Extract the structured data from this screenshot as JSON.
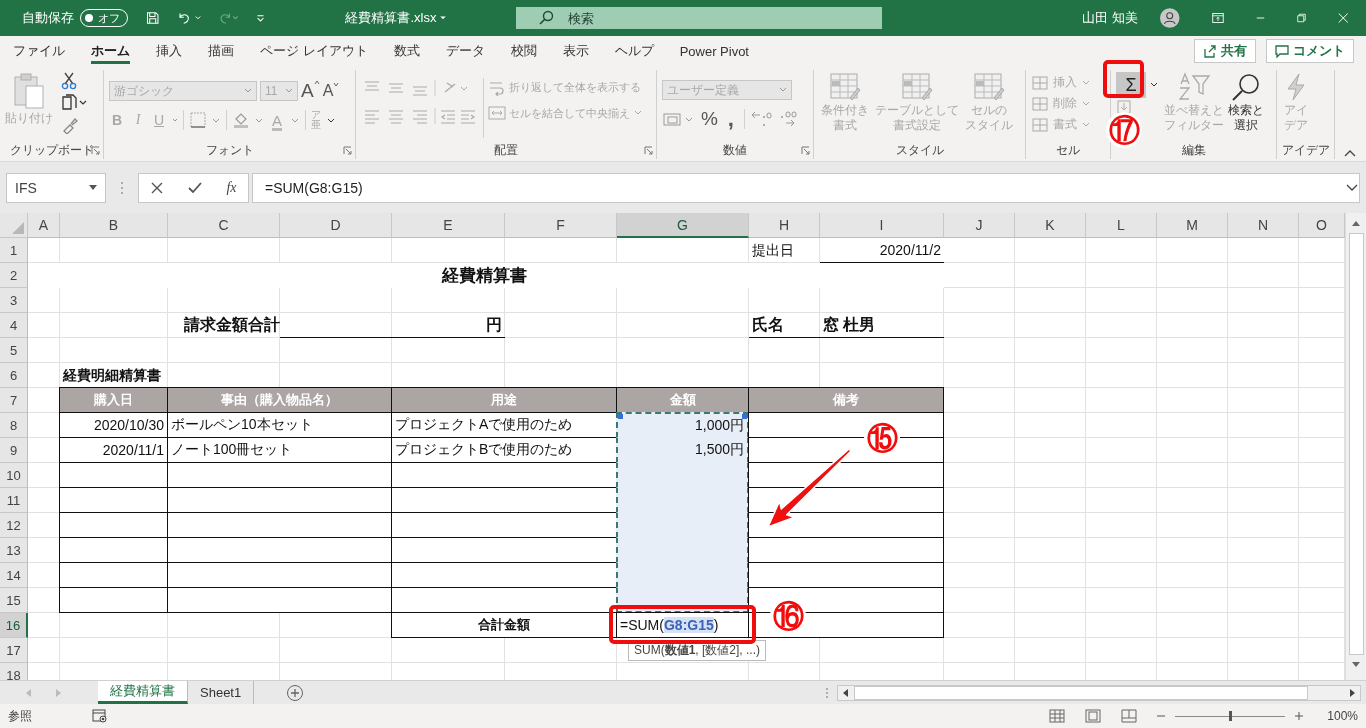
{
  "titlebar": {
    "autosave_label": "自動保存",
    "autosave": {
      "label": "オフ",
      "on": false
    },
    "redo": {
      "disabled": true
    },
    "filename": "経費精算書.xlsx",
    "search": {
      "placeholder": "検索"
    },
    "user": "山田 知美"
  },
  "tabs": [
    {
      "label": "ファイル",
      "selected": false
    },
    {
      "label": "ホーム",
      "selected": true
    },
    {
      "label": "挿入",
      "selected": false
    },
    {
      "label": "描画",
      "selected": false
    },
    {
      "label": "ページ レイアウト",
      "selected": false
    },
    {
      "label": "数式",
      "selected": false
    },
    {
      "label": "データ",
      "selected": false
    },
    {
      "label": "校閲",
      "selected": false
    },
    {
      "label": "表示",
      "selected": false
    },
    {
      "label": "ヘルプ",
      "selected": false
    },
    {
      "label": "Power Pivot",
      "selected": false
    }
  ],
  "share_button": "共有",
  "comment_button": "コメント",
  "ribbon": {
    "groups": [
      {
        "kind": "clipboard",
        "label": "クリップボード",
        "launcher": true,
        "items": [
          {
            "label": [
              "貼り付け"
            ],
            "disabled": true
          }
        ]
      },
      {
        "kind": "font",
        "label": "フォント",
        "launcher": true,
        "items": [
          {
            "value": "游ゴシック",
            "disabled": true
          },
          {
            "value": "11",
            "disabled": true
          },
          {
            "label": "A",
            "disabled": false
          },
          {
            "label": "A",
            "disabled": false
          },
          {
            "label": "B",
            "disabled": true
          },
          {
            "label": "I",
            "disabled": true
          },
          {
            "label": "U",
            "disabled": true
          },
          {
            "label": "A",
            "disabled": true
          },
          {
            "label": "ア亜",
            "disabled": true
          }
        ]
      },
      {
        "kind": "alignment",
        "label": "配置",
        "launcher": true,
        "items": [
          {
            "label": "折り返して全体を表示する",
            "disabled": true
          },
          {
            "label": "セルを結合して中央揃え",
            "disabled": true
          }
        ]
      },
      {
        "kind": "number",
        "label": "数値",
        "launcher": true,
        "items": [
          {
            "value": "ユーザー定義",
            "disabled": true
          },
          {
            "label": "%",
            "disabled": false
          },
          {
            "label": ",",
            "disabled": false
          }
        ]
      },
      {
        "kind": "styles",
        "label": "スタイル",
        "items": [
          {
            "label": [
              "条件付き",
              "書式"
            ],
            "disabled": true
          },
          {
            "label": [
              "テーブルとして",
              "書式設定"
            ],
            "disabled": true
          },
          {
            "label": [
              "セルの",
              "スタイル"
            ],
            "disabled": true
          }
        ]
      },
      {
        "kind": "cells",
        "label": "セル",
        "items": [
          {
            "label": "挿入",
            "disabled": true
          },
          {
            "label": "削除",
            "disabled": true
          },
          {
            "label": "書式",
            "disabled": true
          }
        ]
      },
      {
        "kind": "editing",
        "label": "編集",
        "items": [
          {
            "label": "Σ",
            "disabled": false
          },
          {
            "label": [
              "並べ替えと",
              "フィルター"
            ],
            "disabled": true
          },
          {
            "label": [
              "検索と",
              "選択"
            ],
            "disabled": false
          }
        ]
      },
      {
        "kind": "ideas",
        "label": "アイデア",
        "items": [
          {
            "label": [
              "アイ",
              "デア"
            ],
            "disabled": true
          }
        ]
      }
    ]
  },
  "formula_bar": {
    "name_box": "IFS",
    "function_button": "fx",
    "formula": "=SUM(G8:G15)"
  },
  "sheet": {
    "columns": [
      {
        "label": "A",
        "selected": false
      },
      {
        "label": "B",
        "selected": false
      },
      {
        "label": "C",
        "selected": false
      },
      {
        "label": "D",
        "selected": false
      },
      {
        "label": "E",
        "selected": false
      },
      {
        "label": "F",
        "selected": false
      },
      {
        "label": "G",
        "selected": true
      },
      {
        "label": "H",
        "selected": false
      },
      {
        "label": "I",
        "selected": false
      },
      {
        "label": "J",
        "selected": false
      },
      {
        "label": "K",
        "selected": false
      },
      {
        "label": "L",
        "selected": false
      },
      {
        "label": "M",
        "selected": false
      },
      {
        "label": "N",
        "selected": false
      },
      {
        "label": "O",
        "selected": false
      }
    ],
    "rows": [
      {
        "number": "1",
        "selected": false,
        "cells": [
          "",
          "",
          "",
          "",
          "",
          "",
          "",
          {
            "text": "提出日",
            "kind": "plain"
          },
          {
            "text": "2020/11/2",
            "kind": "underline-right"
          }
        ]
      },
      {
        "number": "2",
        "selected": false,
        "cells": [
          "",
          "",
          "",
          "",
          {
            "text": "経費精算書",
            "kind": "title"
          }
        ]
      },
      {
        "number": "3",
        "selected": false
      },
      {
        "number": "4",
        "selected": false,
        "cells": [
          "",
          "",
          {
            "text": "請求金額合計",
            "kind": "label-right"
          },
          {
            "kind": "underline"
          },
          {
            "text": "円",
            "kind": "underline-bold-right"
          },
          "",
          "",
          {
            "text": "氏名",
            "kind": "underline-bold"
          },
          {
            "text": "窓 杜男",
            "kind": "underline-bold"
          }
        ]
      },
      {
        "number": "5",
        "selected": false
      },
      {
        "number": "6",
        "selected": false,
        "cells": [
          "",
          {
            "text": "経費明細精算書",
            "kind": "section"
          }
        ]
      },
      {
        "number": "7",
        "selected": false,
        "cells": [
          "",
          {
            "text": "購入日",
            "kind": "header",
            "merged": false
          },
          {
            "text": "事由（購入物品名）",
            "kind": "header",
            "merged": true
          },
          "",
          {
            "text": "用途",
            "kind": "header",
            "merged": true
          },
          "",
          {
            "text": "金額",
            "kind": "header",
            "merged": false
          },
          {
            "text": "備考",
            "kind": "header",
            "merged": true
          }
        ]
      },
      {
        "number": "8",
        "selected": false,
        "cells": [
          "",
          {
            "text": "2020/10/30",
            "kind": "date",
            "merged": false
          },
          {
            "text": "ボールペン10本セット",
            "kind": "text",
            "merged": true
          },
          "",
          {
            "text": "プロジェクトAで使用のため",
            "kind": "text",
            "merged": true
          },
          "",
          {
            "text": "1,000円",
            "kind": "amount",
            "merged": false,
            "copy_range": true
          },
          {
            "kind": "box",
            "merged": true
          }
        ]
      },
      {
        "number": "9",
        "selected": false,
        "cells": [
          "",
          {
            "text": "2020/11/1",
            "kind": "date",
            "merged": false
          },
          {
            "text": "ノート100冊セット",
            "kind": "text",
            "merged": true
          },
          "",
          {
            "text": "プロジェクトBで使用のため",
            "kind": "text",
            "merged": true
          },
          "",
          {
            "text": "1,500円",
            "kind": "amount",
            "merged": false,
            "copy_range": true
          },
          {
            "kind": "box",
            "merged": true
          }
        ]
      },
      {
        "number": "10",
        "selected": false,
        "cells": [
          "",
          {
            "kind": "box",
            "merged": false
          },
          {
            "kind": "box",
            "merged": true
          },
          "",
          {
            "kind": "box",
            "merged": true
          },
          "",
          {
            "kind": "amount",
            "merged": false,
            "copy_range": true
          },
          {
            "kind": "box",
            "merged": true
          }
        ]
      },
      {
        "number": "11",
        "selected": false,
        "cells": [
          "",
          {
            "kind": "box",
            "merged": false
          },
          {
            "kind": "box",
            "merged": true
          },
          "",
          {
            "kind": "box",
            "merged": true
          },
          "",
          {
            "kind": "amount",
            "merged": false,
            "copy_range": true
          },
          {
            "kind": "box",
            "merged": true
          }
        ]
      },
      {
        "number": "12",
        "selected": false,
        "cells": [
          "",
          {
            "kind": "box",
            "merged": false
          },
          {
            "kind": "box",
            "merged": true
          },
          "",
          {
            "kind": "box",
            "merged": true
          },
          "",
          {
            "kind": "amount",
            "merged": false,
            "copy_range": true
          },
          {
            "kind": "box",
            "merged": true
          }
        ]
      },
      {
        "number": "13",
        "selected": false,
        "cells": [
          "",
          {
            "kind": "box",
            "merged": false
          },
          {
            "kind": "box",
            "merged": true
          },
          "",
          {
            "kind": "box",
            "merged": true
          },
          "",
          {
            "kind": "amount",
            "merged": false,
            "copy_range": true
          },
          {
            "kind": "box",
            "merged": true
          }
        ]
      },
      {
        "number": "14",
        "selected": false,
        "cells": [
          "",
          {
            "kind": "box",
            "merged": false
          },
          {
            "kind": "box",
            "merged": true
          },
          "",
          {
            "kind": "box",
            "merged": true
          },
          "",
          {
            "kind": "amount",
            "merged": false,
            "copy_range": true
          },
          {
            "kind": "box",
            "merged": true
          }
        ]
      },
      {
        "number": "15",
        "selected": false,
        "cells": [
          "",
          {
            "kind": "box",
            "merged": false
          },
          {
            "kind": "box",
            "merged": true
          },
          "",
          {
            "kind": "box",
            "merged": true
          },
          "",
          {
            "kind": "amount",
            "merged": false,
            "copy_range": true
          },
          {
            "kind": "box",
            "merged": true
          }
        ]
      },
      {
        "number": "16",
        "selected": true,
        "cells": [
          "",
          "",
          "",
          "",
          {
            "text": "合計金額",
            "kind": "total",
            "merged": true
          },
          "",
          {
            "text": "=SUM(**G8:G15**)",
            "kind": "formula",
            "merged": false
          },
          {
            "kind": "box",
            "merged": true
          }
        ]
      },
      {
        "number": "17",
        "selected": false
      },
      {
        "number": "18",
        "selected": false
      }
    ],
    "tooltip": "SUM(**数値1**, [数値2], ...)"
  },
  "annotations": [
    {
      "text": "⑮"
    },
    {
      "text": "⑯"
    },
    {
      "text": "⑰"
    }
  ],
  "sheet_tabs": [
    {
      "label": "経費精算書",
      "selected": true
    },
    {
      "label": "Sheet1",
      "selected": false
    }
  ],
  "status_bar": {
    "mode": "参照",
    "zoom": {
      "label": "100%",
      "level": 0.5
    }
  }
}
